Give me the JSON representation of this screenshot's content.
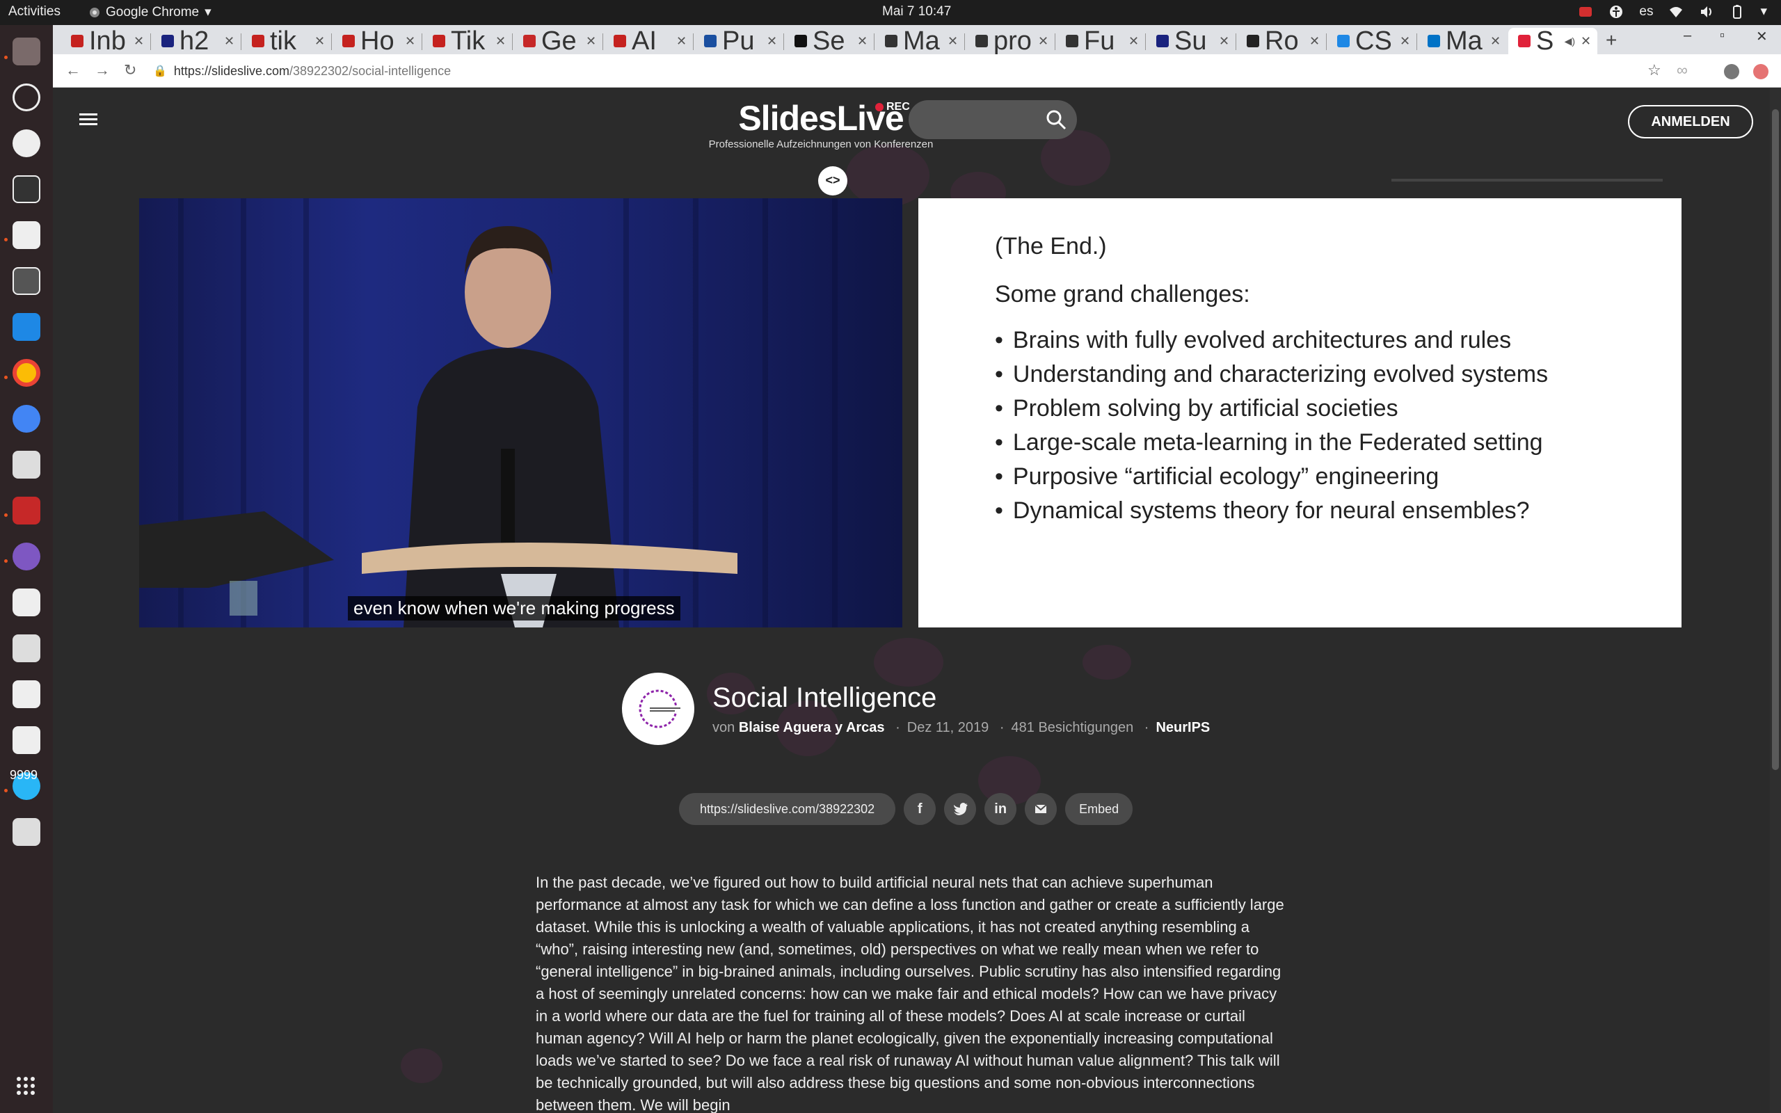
{
  "topbar": {
    "activities": "Activities",
    "app_menu": "Google Chrome",
    "clock": "Mai 7  10:47",
    "lang": "es"
  },
  "dock": {
    "badge": "9999"
  },
  "tabs": [
    {
      "label": "Inb",
      "color": "#c5221f"
    },
    {
      "label": "h2",
      "color": "#1a237e"
    },
    {
      "label": "tik",
      "color": "#c5221f"
    },
    {
      "label": "Ho",
      "color": "#c5221f"
    },
    {
      "label": "Tik",
      "color": "#c5221f"
    },
    {
      "label": "Ge",
      "color": "#c62828"
    },
    {
      "label": "AI",
      "color": "#c5221f"
    },
    {
      "label": "Pu",
      "color": "#1a4fa0"
    },
    {
      "label": "Se",
      "color": "#111111"
    },
    {
      "label": "Ma",
      "color": "#333333"
    },
    {
      "label": "pro",
      "color": "#333333"
    },
    {
      "label": "Fu",
      "color": "#333333"
    },
    {
      "label": "Su",
      "color": "#1a237e"
    },
    {
      "label": "Ro",
      "color": "#222222"
    },
    {
      "label": "CS",
      "color": "#1e88e5"
    },
    {
      "label": "Ma",
      "color": "#0072c6"
    },
    {
      "label": "S",
      "color": "#e0223a"
    }
  ],
  "browser": {
    "url_host": "https://slideslive.com",
    "url_path": "/38922302/social-intelligence"
  },
  "site": {
    "logo": "SlidesLive",
    "rec": "REC",
    "tagline": "Professionelle Aufzeichnungen von Konferenzen",
    "login": "ANMELDEN"
  },
  "video": {
    "caption": "even know when we're making progress"
  },
  "slide": {
    "line1": "(The End.)",
    "line2": "Some grand challenges:",
    "bullets": [
      "Brains with fully evolved architectures and rules",
      "Understanding and characterizing evolved systems",
      "Problem solving by artificial societies",
      "Large-scale meta-learning in the Federated setting",
      "Purposive “artificial ecology” engineering",
      "Dynamical systems theory for neural ensembles?"
    ]
  },
  "talk": {
    "title": "Social Intelligence",
    "by": "von",
    "author": "Blaise Aguera y Arcas",
    "date": "Dez 11, 2019",
    "views": "481 Besichtigungen",
    "venue": "NeurIPS"
  },
  "share": {
    "link": "https://slideslive.com/38922302",
    "facebook": "f",
    "linkedin": "in",
    "embed": "Embed"
  },
  "abstract": "In the past decade, we’ve figured out how to build artificial neural nets that can achieve superhuman performance at almost any task for which we can define a loss function and gather or create a sufficiently large dataset. While this is unlocking a wealth of valuable applications, it has not created anything resembling a “who”, raising interesting new (and, sometimes, old) perspectives on what we really mean when we refer to “general intelligence” in big-brained animals, including ourselves. Public scrutiny has also intensified regarding a host of seemingly unrelated concerns: how can we make fair and ethical models? How can we have privacy in a world where our data are the fuel for training all of these models? Does AI at scale increase or curtail human agency? Will AI help or harm the planet ecologically, given the exponentially increasing computational loads we’ve started to see? Do we face a real risk of runaway AI without human value alignment? This talk will be technically grounded, but will also address these big questions and some non-obvious interconnections between them. We will begin"
}
